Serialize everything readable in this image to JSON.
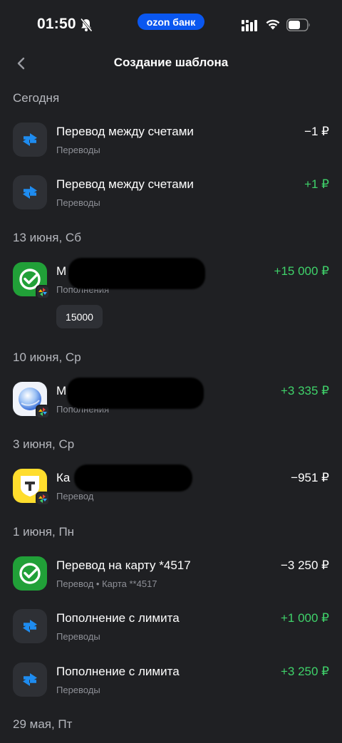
{
  "status_bar": {
    "time": "01:50",
    "carrier_pill": "ozon банк"
  },
  "header": {
    "title": "Создание шаблона"
  },
  "sections": [
    {
      "date": "Сегодня",
      "items": [
        {
          "title": "Перевод между счетами",
          "subtitle": "Переводы",
          "amount": "−1 ₽",
          "icon": "transfer-arrows-icon",
          "positive": false
        },
        {
          "title": "Перевод между счетами",
          "subtitle": "Переводы",
          "amount": "+1 ₽",
          "icon": "transfer-arrows-icon",
          "positive": true
        }
      ]
    },
    {
      "date": "13 июня, Сб",
      "items": [
        {
          "title": "М",
          "subtitle": "Пополнения",
          "amount": "+15 000 ₽",
          "icon": "sber-logo-icon",
          "positive": true,
          "tag": "15000"
        }
      ]
    },
    {
      "date": "10 июня, Ср",
      "items": [
        {
          "title": "М",
          "subtitle": "Пополнения",
          "amount": "+3 335 ₽",
          "icon": "marusya-logo-icon",
          "positive": true
        }
      ]
    },
    {
      "date": "3 июня, Ср",
      "items": [
        {
          "title": "Ка",
          "subtitle": "Перевод",
          "amount": "−951 ₽",
          "icon": "tbank-logo-icon",
          "positive": false
        }
      ]
    },
    {
      "date": "1 июня, Пн",
      "items": [
        {
          "title": "Перевод на карту *4517",
          "subtitle": "Перевод • Карта **4517",
          "amount": "−3 250 ₽",
          "icon": "sber-logo-icon",
          "positive": false
        },
        {
          "title": "Пополнение с лимита",
          "subtitle": "Переводы",
          "amount": "+1 000 ₽",
          "icon": "transfer-arrows-icon",
          "positive": true
        },
        {
          "title": "Пополнение с лимита",
          "subtitle": "Переводы",
          "amount": "+3 250 ₽",
          "icon": "transfer-arrows-icon",
          "positive": true
        }
      ]
    },
    {
      "date": "29 мая, Пт",
      "items": []
    }
  ]
}
